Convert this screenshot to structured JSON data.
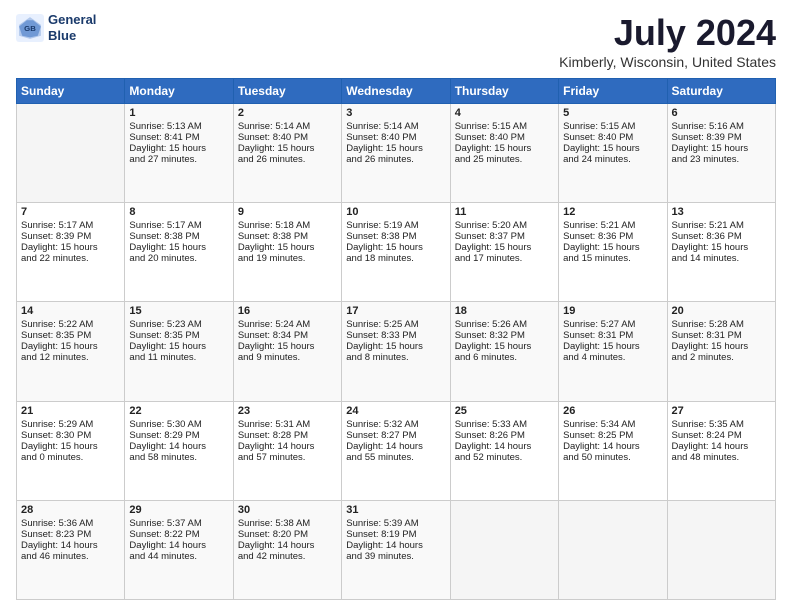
{
  "header": {
    "logo_line1": "General",
    "logo_line2": "Blue",
    "title": "July 2024",
    "subtitle": "Kimberly, Wisconsin, United States"
  },
  "days_of_week": [
    "Sunday",
    "Monday",
    "Tuesday",
    "Wednesday",
    "Thursday",
    "Friday",
    "Saturday"
  ],
  "weeks": [
    [
      {
        "day": "",
        "content": ""
      },
      {
        "day": "1",
        "content": "Sunrise: 5:13 AM\nSunset: 8:41 PM\nDaylight: 15 hours\nand 27 minutes."
      },
      {
        "day": "2",
        "content": "Sunrise: 5:14 AM\nSunset: 8:40 PM\nDaylight: 15 hours\nand 26 minutes."
      },
      {
        "day": "3",
        "content": "Sunrise: 5:14 AM\nSunset: 8:40 PM\nDaylight: 15 hours\nand 26 minutes."
      },
      {
        "day": "4",
        "content": "Sunrise: 5:15 AM\nSunset: 8:40 PM\nDaylight: 15 hours\nand 25 minutes."
      },
      {
        "day": "5",
        "content": "Sunrise: 5:15 AM\nSunset: 8:40 PM\nDaylight: 15 hours\nand 24 minutes."
      },
      {
        "day": "6",
        "content": "Sunrise: 5:16 AM\nSunset: 8:39 PM\nDaylight: 15 hours\nand 23 minutes."
      }
    ],
    [
      {
        "day": "7",
        "content": "Sunrise: 5:17 AM\nSunset: 8:39 PM\nDaylight: 15 hours\nand 22 minutes."
      },
      {
        "day": "8",
        "content": "Sunrise: 5:17 AM\nSunset: 8:38 PM\nDaylight: 15 hours\nand 20 minutes."
      },
      {
        "day": "9",
        "content": "Sunrise: 5:18 AM\nSunset: 8:38 PM\nDaylight: 15 hours\nand 19 minutes."
      },
      {
        "day": "10",
        "content": "Sunrise: 5:19 AM\nSunset: 8:38 PM\nDaylight: 15 hours\nand 18 minutes."
      },
      {
        "day": "11",
        "content": "Sunrise: 5:20 AM\nSunset: 8:37 PM\nDaylight: 15 hours\nand 17 minutes."
      },
      {
        "day": "12",
        "content": "Sunrise: 5:21 AM\nSunset: 8:36 PM\nDaylight: 15 hours\nand 15 minutes."
      },
      {
        "day": "13",
        "content": "Sunrise: 5:21 AM\nSunset: 8:36 PM\nDaylight: 15 hours\nand 14 minutes."
      }
    ],
    [
      {
        "day": "14",
        "content": "Sunrise: 5:22 AM\nSunset: 8:35 PM\nDaylight: 15 hours\nand 12 minutes."
      },
      {
        "day": "15",
        "content": "Sunrise: 5:23 AM\nSunset: 8:35 PM\nDaylight: 15 hours\nand 11 minutes."
      },
      {
        "day": "16",
        "content": "Sunrise: 5:24 AM\nSunset: 8:34 PM\nDaylight: 15 hours\nand 9 minutes."
      },
      {
        "day": "17",
        "content": "Sunrise: 5:25 AM\nSunset: 8:33 PM\nDaylight: 15 hours\nand 8 minutes."
      },
      {
        "day": "18",
        "content": "Sunrise: 5:26 AM\nSunset: 8:32 PM\nDaylight: 15 hours\nand 6 minutes."
      },
      {
        "day": "19",
        "content": "Sunrise: 5:27 AM\nSunset: 8:31 PM\nDaylight: 15 hours\nand 4 minutes."
      },
      {
        "day": "20",
        "content": "Sunrise: 5:28 AM\nSunset: 8:31 PM\nDaylight: 15 hours\nand 2 minutes."
      }
    ],
    [
      {
        "day": "21",
        "content": "Sunrise: 5:29 AM\nSunset: 8:30 PM\nDaylight: 15 hours\nand 0 minutes."
      },
      {
        "day": "22",
        "content": "Sunrise: 5:30 AM\nSunset: 8:29 PM\nDaylight: 14 hours\nand 58 minutes."
      },
      {
        "day": "23",
        "content": "Sunrise: 5:31 AM\nSunset: 8:28 PM\nDaylight: 14 hours\nand 57 minutes."
      },
      {
        "day": "24",
        "content": "Sunrise: 5:32 AM\nSunset: 8:27 PM\nDaylight: 14 hours\nand 55 minutes."
      },
      {
        "day": "25",
        "content": "Sunrise: 5:33 AM\nSunset: 8:26 PM\nDaylight: 14 hours\nand 52 minutes."
      },
      {
        "day": "26",
        "content": "Sunrise: 5:34 AM\nSunset: 8:25 PM\nDaylight: 14 hours\nand 50 minutes."
      },
      {
        "day": "27",
        "content": "Sunrise: 5:35 AM\nSunset: 8:24 PM\nDaylight: 14 hours\nand 48 minutes."
      }
    ],
    [
      {
        "day": "28",
        "content": "Sunrise: 5:36 AM\nSunset: 8:23 PM\nDaylight: 14 hours\nand 46 minutes."
      },
      {
        "day": "29",
        "content": "Sunrise: 5:37 AM\nSunset: 8:22 PM\nDaylight: 14 hours\nand 44 minutes."
      },
      {
        "day": "30",
        "content": "Sunrise: 5:38 AM\nSunset: 8:20 PM\nDaylight: 14 hours\nand 42 minutes."
      },
      {
        "day": "31",
        "content": "Sunrise: 5:39 AM\nSunset: 8:19 PM\nDaylight: 14 hours\nand 39 minutes."
      },
      {
        "day": "",
        "content": ""
      },
      {
        "day": "",
        "content": ""
      },
      {
        "day": "",
        "content": ""
      }
    ]
  ]
}
